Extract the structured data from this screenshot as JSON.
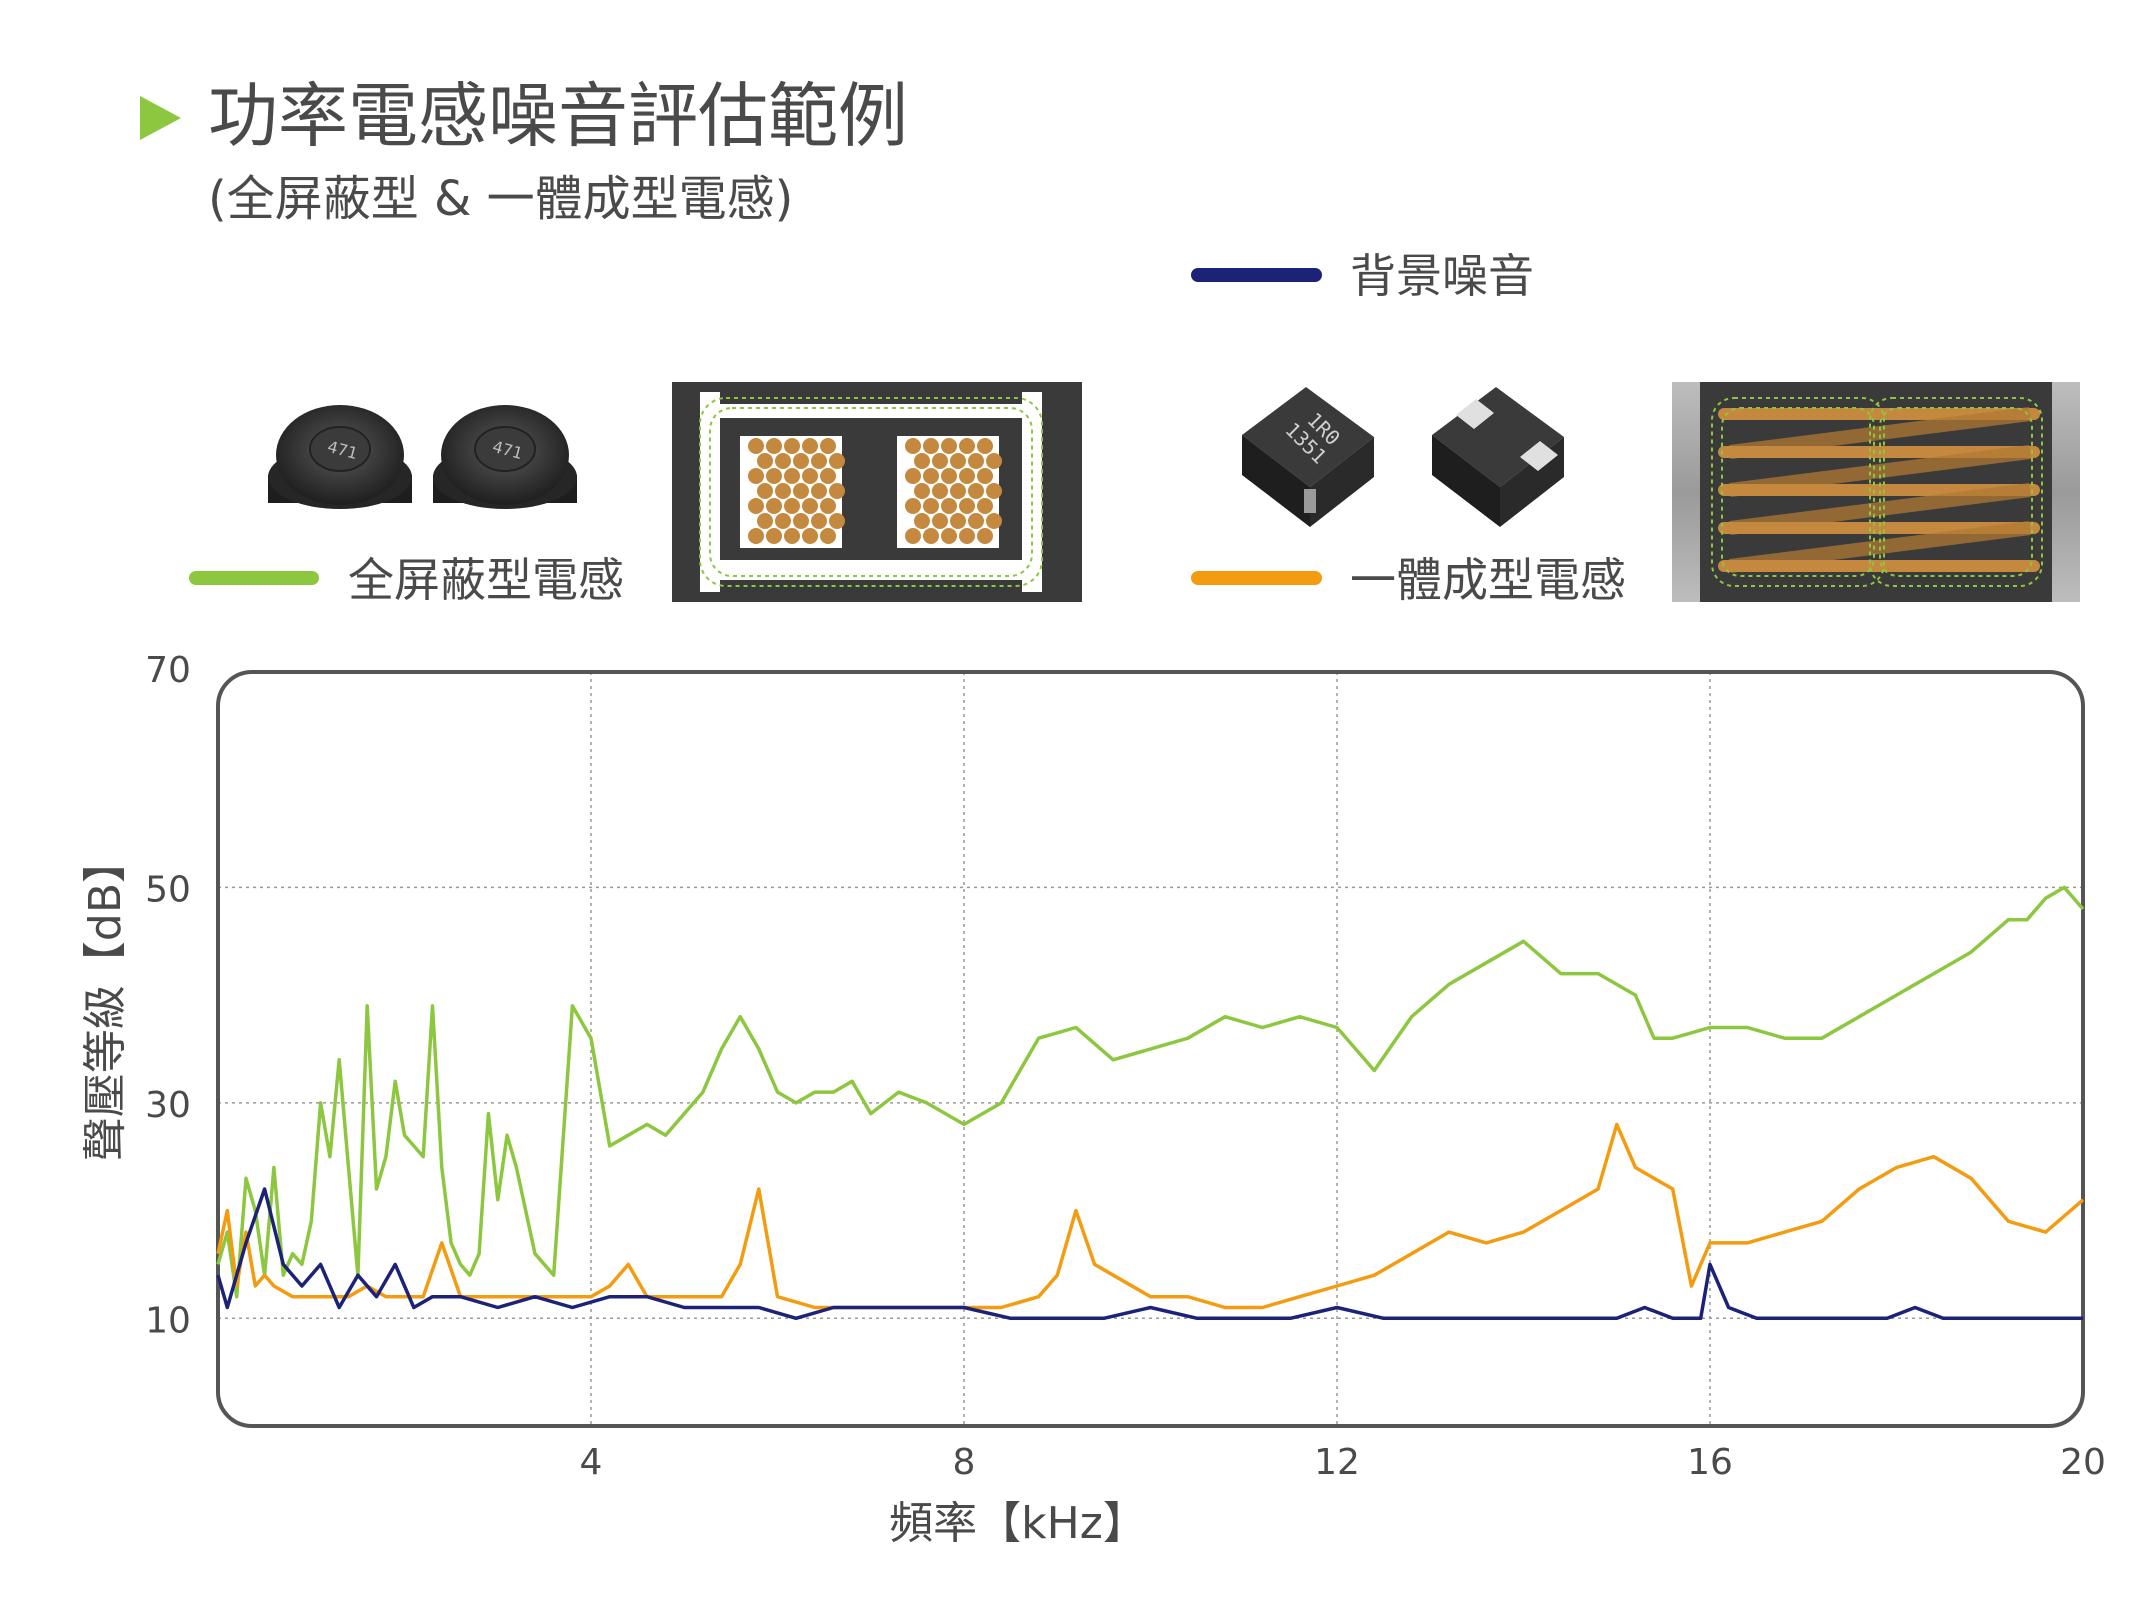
{
  "header": {
    "title": "功率電感噪音評估範例",
    "subtitle": "(全屏蔽型 & 一體成型電感)"
  },
  "legend": {
    "background_label": "背景噪音",
    "shielded_label": "全屏蔽型電感",
    "molded_label": "一體成型電感"
  },
  "components": {
    "shielded_marking": "471",
    "molded_marking_line1": "1R0",
    "molded_marking_line2": "1351"
  },
  "colors": {
    "background_noise": "#1c2278",
    "shielded": "#8dc63f",
    "molded": "#f39c12",
    "accent": "#8dc63f",
    "text": "#4a4a4a",
    "frame": "#555555"
  },
  "chart_data": {
    "type": "line",
    "xlabel": "頻率【kHz】",
    "ylabel": "聲壓等級【dB】",
    "xlim": [
      0,
      20
    ],
    "ylim": [
      0,
      70
    ],
    "xticks": [
      4,
      8,
      12,
      16,
      20
    ],
    "yticks": [
      10,
      30,
      50,
      70
    ],
    "grid": true,
    "series": [
      {
        "name": "背景噪音",
        "x": [
          0.0,
          0.1,
          0.3,
          0.5,
          0.7,
          0.9,
          1.1,
          1.3,
          1.5,
          1.7,
          1.9,
          2.1,
          2.3,
          2.6,
          3.0,
          3.4,
          3.8,
          4.2,
          4.6,
          5.0,
          5.4,
          5.8,
          6.2,
          6.6,
          7.0,
          7.5,
          8.0,
          8.5,
          9.0,
          9.5,
          10.0,
          10.5,
          11.0,
          11.5,
          12.0,
          12.5,
          13.0,
          13.5,
          14.0,
          14.5,
          15.0,
          15.3,
          15.6,
          15.9,
          16.0,
          16.2,
          16.5,
          16.8,
          17.0,
          17.3,
          17.6,
          17.9,
          18.2,
          18.5,
          18.8,
          19.1,
          19.4,
          19.7,
          20.0
        ],
        "values": [
          14,
          11,
          17,
          22,
          15,
          13,
          15,
          11,
          14,
          12,
          15,
          11,
          12,
          12,
          11,
          12,
          11,
          12,
          12,
          11,
          11,
          11,
          10,
          11,
          11,
          11,
          11,
          10,
          10,
          10,
          11,
          10,
          10,
          10,
          11,
          10,
          10,
          10,
          10,
          10,
          10,
          11,
          10,
          10,
          15,
          11,
          10,
          10,
          10,
          10,
          10,
          10,
          11,
          10,
          10,
          10,
          10,
          10,
          10
        ]
      },
      {
        "name": "全屏蔽型電感",
        "x": [
          0.0,
          0.1,
          0.2,
          0.3,
          0.4,
          0.5,
          0.6,
          0.7,
          0.8,
          0.9,
          1.0,
          1.1,
          1.2,
          1.3,
          1.4,
          1.5,
          1.6,
          1.7,
          1.8,
          1.9,
          2.0,
          2.1,
          2.2,
          2.3,
          2.4,
          2.5,
          2.6,
          2.7,
          2.8,
          2.9,
          3.0,
          3.1,
          3.2,
          3.4,
          3.6,
          3.8,
          4.0,
          4.2,
          4.4,
          4.6,
          4.8,
          5.0,
          5.2,
          5.4,
          5.6,
          5.8,
          6.0,
          6.2,
          6.4,
          6.6,
          6.8,
          7.0,
          7.3,
          7.6,
          8.0,
          8.4,
          8.8,
          9.2,
          9.6,
          10.0,
          10.4,
          10.8,
          11.2,
          11.6,
          12.0,
          12.4,
          12.8,
          13.2,
          13.6,
          14.0,
          14.4,
          14.8,
          15.2,
          15.4,
          15.6,
          16.0,
          16.4,
          16.8,
          17.2,
          17.6,
          18.0,
          18.4,
          18.8,
          19.2,
          19.4,
          19.6,
          19.8,
          20.0
        ],
        "values": [
          15,
          18,
          12,
          23,
          20,
          14,
          24,
          14,
          16,
          15,
          19,
          30,
          25,
          34,
          24,
          14,
          39,
          22,
          25,
          32,
          27,
          26,
          25,
          39,
          24,
          17,
          15,
          14,
          16,
          29,
          21,
          27,
          24,
          16,
          14,
          39,
          36,
          26,
          27,
          28,
          27,
          29,
          31,
          35,
          38,
          35,
          31,
          30,
          31,
          31,
          32,
          29,
          31,
          30,
          28,
          30,
          36,
          37,
          34,
          35,
          36,
          38,
          37,
          38,
          37,
          33,
          38,
          41,
          43,
          45,
          42,
          42,
          40,
          36,
          36,
          37,
          37,
          36,
          36,
          38,
          40,
          42,
          44,
          47,
          47,
          49,
          50,
          48
        ],
        "values_note": "approx"
      },
      {
        "name": "一體成型電感",
        "x": [
          0.0,
          0.1,
          0.2,
          0.3,
          0.4,
          0.5,
          0.6,
          0.8,
          1.0,
          1.2,
          1.4,
          1.6,
          1.8,
          2.0,
          2.2,
          2.4,
          2.6,
          2.8,
          3.0,
          3.2,
          3.4,
          3.6,
          3.8,
          4.0,
          4.2,
          4.4,
          4.6,
          4.8,
          5.0,
          5.2,
          5.4,
          5.6,
          5.8,
          6.0,
          6.4,
          6.8,
          7.2,
          7.6,
          8.0,
          8.4,
          8.8,
          9.0,
          9.2,
          9.4,
          9.6,
          10.0,
          10.4,
          10.8,
          11.2,
          11.6,
          12.0,
          12.4,
          12.8,
          13.2,
          13.6,
          14.0,
          14.4,
          14.8,
          15.0,
          15.2,
          15.4,
          15.6,
          15.8,
          16.0,
          16.4,
          16.8,
          17.2,
          17.6,
          18.0,
          18.4,
          18.8,
          19.2,
          19.6,
          20.0
        ],
        "values": [
          16,
          20,
          13,
          18,
          13,
          14,
          13,
          12,
          12,
          12,
          12,
          13,
          12,
          12,
          12,
          17,
          12,
          12,
          12,
          12,
          12,
          12,
          12,
          12,
          13,
          15,
          12,
          12,
          12,
          12,
          12,
          15,
          22,
          12,
          11,
          11,
          11,
          11,
          11,
          11,
          12,
          14,
          20,
          15,
          14,
          12,
          12,
          11,
          11,
          12,
          13,
          14,
          16,
          18,
          17,
          18,
          20,
          22,
          28,
          24,
          23,
          22,
          13,
          17,
          17,
          18,
          19,
          22,
          24,
          25,
          23,
          19,
          18,
          21
        ]
      }
    ]
  }
}
